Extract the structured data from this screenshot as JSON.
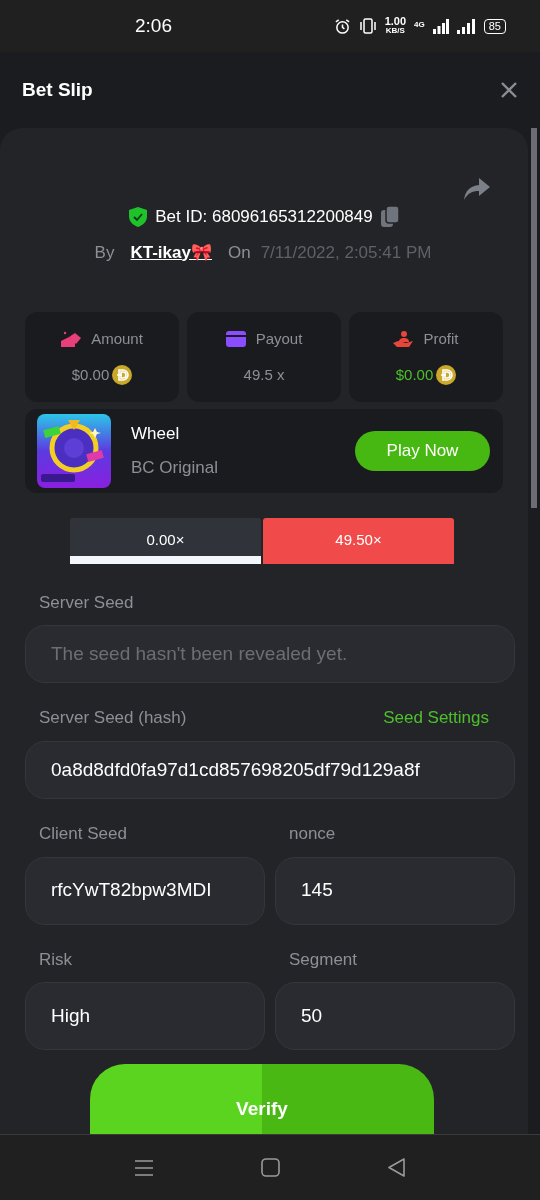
{
  "status_bar": {
    "time": "2:06",
    "net_speed": "1.00",
    "net_unit": "KB/S",
    "network": "4G",
    "battery": "85"
  },
  "header": {
    "title": "Bet Slip"
  },
  "bet": {
    "id_label": "Bet ID: 68096165312200849",
    "by_label": "By",
    "user": "KT-ikay🎀",
    "on_label": "On",
    "date": "7/11/2022, 2:05:41 PM"
  },
  "stats": [
    {
      "kind": "amount",
      "label": "Amount",
      "value": "$0.00",
      "coin": true,
      "color": "#e83e7a",
      "positive": false
    },
    {
      "kind": "payout",
      "label": "Payout",
      "value": "49.5 x",
      "coin": false,
      "color": "#8a4dff",
      "positive": false
    },
    {
      "kind": "profit",
      "label": "Profit",
      "value": "$0.00",
      "coin": true,
      "color": "#e8463a",
      "positive": true
    }
  ],
  "game": {
    "name": "Wheel",
    "subtitle": "BC Original",
    "button": "Play Now"
  },
  "multipliers": [
    {
      "label": "0.00×",
      "color": "#31333a",
      "selected": true
    },
    {
      "label": "49.50×",
      "color": "#f14a4a",
      "selected": false
    }
  ],
  "fields": [
    {
      "label": "Server Seed",
      "placeholder": "The seed hasn't been revealed yet."
    },
    {
      "label": "Server Seed (hash)",
      "link": "Seed Settings",
      "value": "0a8d8dfd0fa97d1cd857698205df79d129a8f"
    }
  ],
  "pairs": [
    [
      {
        "label": "Client Seed",
        "value": "rfcYwT82bpw3MDI"
      },
      {
        "label": "nonce",
        "value": "145"
      }
    ],
    [
      {
        "label": "Risk",
        "value": "High"
      },
      {
        "label": "Segment",
        "value": "50"
      }
    ]
  ],
  "verify_button": "Verify"
}
